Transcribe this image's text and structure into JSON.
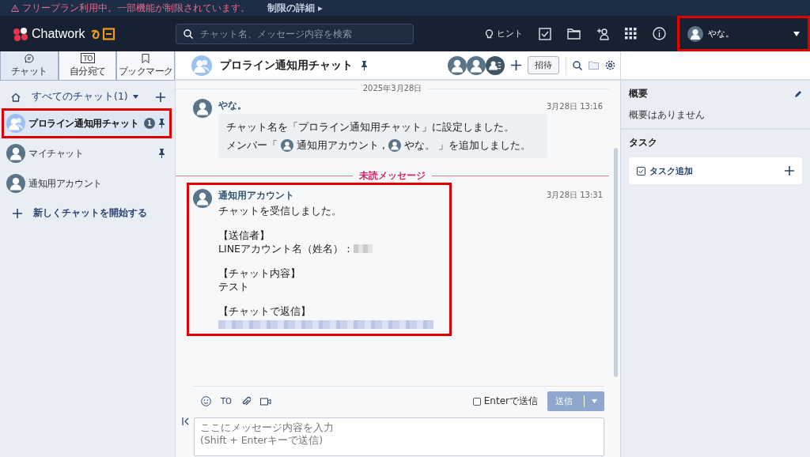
{
  "banner": {
    "warning": "フリープラン利用中。一部機能が制限されています。",
    "link": "制限の詳細",
    "arrow": "▸"
  },
  "header": {
    "logo": "Chatwork",
    "search_placeholder": "チャット名、メッセージ内容を検索",
    "hint": "ヒント",
    "user": {
      "name": "やな。",
      "highlighted": true
    }
  },
  "sidebar": {
    "tabs": [
      {
        "kind": "chat",
        "label": "チャット",
        "selected": true
      },
      {
        "kind": "to",
        "label": "自分宛て",
        "icon_text": "TO",
        "selected": false
      },
      {
        "kind": "bookmark",
        "label": "ブックマーク",
        "selected": false
      }
    ],
    "filter": "すべてのチャット(1)",
    "chats": [
      {
        "group_avatar": true,
        "name": "プロライン通知用チャット",
        "unread": "1",
        "pinned": true,
        "selected": true,
        "highlighted": true
      },
      {
        "group_avatar": false,
        "name": "マイチャット",
        "pinned": true,
        "selected": false,
        "highlighted": false
      },
      {
        "group_avatar": false,
        "name": "通知用アカウント",
        "pinned": false,
        "selected": false,
        "highlighted": false
      }
    ],
    "new_chat": "新しくチャットを開始する"
  },
  "room": {
    "title": "プロライン通知用チャット",
    "pinned": true,
    "invite": "招待"
  },
  "timeline": {
    "date": "2025年3月28日",
    "messages": [
      {
        "kind": "system",
        "sender": "やな。",
        "time": "3月28日 13:16",
        "highlighted": false,
        "line": "チャット名を「プロライン通知用チャット」に設定しました。",
        "members_prefix": "メンバー「",
        "members": [
          "通知用アカウント",
          "やな。"
        ],
        "member_separator": ",",
        "members_suffix": "」を追加しました。"
      },
      {
        "kind": "divider",
        "label": "未読メッセージ"
      },
      {
        "kind": "text",
        "sender": "通知用アカウント",
        "time": "3月28日 13:31",
        "highlighted": true,
        "lines": [
          {
            "kind": "text",
            "text": "チャットを受信しました。"
          },
          {
            "kind": "gap"
          },
          {
            "kind": "text",
            "text": "【送信者】"
          },
          {
            "kind": "redacted_text",
            "text": "LINEアカウント名（姓名）："
          },
          {
            "kind": "gap"
          },
          {
            "kind": "text",
            "text": "【チャット内容】"
          },
          {
            "kind": "text",
            "text": "テスト"
          },
          {
            "kind": "gap"
          },
          {
            "kind": "text",
            "text": "【チャットで返信】"
          },
          {
            "kind": "redacted_link"
          }
        ]
      }
    ]
  },
  "composer": {
    "to": "TO",
    "enter_send": {
      "label": "Enterで送信",
      "checked": false
    },
    "send": {
      "label": "送信",
      "disabled": true
    },
    "placeholder": "ここにメッセージ内容を入力\n(Shift + Enterキーで送信)"
  },
  "info": {
    "overview_title": "概要",
    "overview_text": "概要はありません",
    "tasks_title": "タスク",
    "add_task": "タスク追加"
  }
}
